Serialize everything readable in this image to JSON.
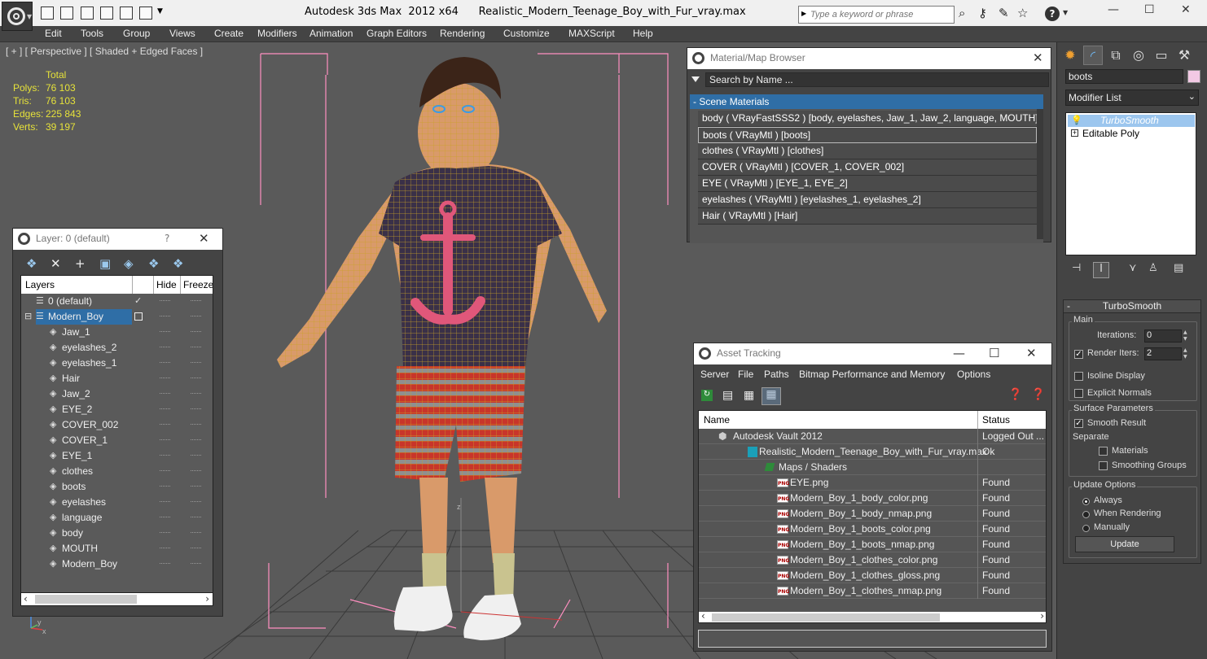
{
  "window": {
    "title": "Autodesk 3ds Max  2012 x64      Realistic_Modern_Teenage_Boy_with_Fur_vray.max",
    "search_placeholder": "Type a keyword or phrase"
  },
  "menu": [
    "Edit",
    "Tools",
    "Group",
    "Views",
    "Create",
    "Modifiers",
    "Animation",
    "Graph Editors",
    "Rendering",
    "Customize",
    "MAXScript",
    "Help"
  ],
  "viewport": {
    "label": "[ + ] [ Perspective ] [ Shaded + Edged Faces ]",
    "stats_header": "Total",
    "stats": [
      {
        "label": "Polys:",
        "value": "76 103"
      },
      {
        "label": "Tris:",
        "value": "76 103"
      },
      {
        "label": "Edges:",
        "value": "225 843"
      },
      {
        "label": "Verts:",
        "value": "39 197"
      }
    ],
    "axis_x": "x",
    "axis_y": "y",
    "axis_z": "z",
    "gizmo_z": "z"
  },
  "layer_panel": {
    "title": "Layer: 0 (default)",
    "help": "?",
    "columns": [
      "Layers",
      "Hide",
      "Freeze"
    ],
    "layers": [
      {
        "name": "0 (default)",
        "level": 0,
        "type": "layer",
        "selected": false,
        "active": true
      },
      {
        "name": "Modern_Boy",
        "level": 0,
        "type": "layer",
        "selected": true,
        "active": false
      },
      {
        "name": "Jaw_1",
        "level": 1,
        "type": "object"
      },
      {
        "name": "eyelashes_2",
        "level": 1,
        "type": "object"
      },
      {
        "name": "eyelashes_1",
        "level": 1,
        "type": "object"
      },
      {
        "name": "Hair",
        "level": 1,
        "type": "object"
      },
      {
        "name": "Jaw_2",
        "level": 1,
        "type": "object"
      },
      {
        "name": "EYE_2",
        "level": 1,
        "type": "object"
      },
      {
        "name": "COVER_002",
        "level": 1,
        "type": "object"
      },
      {
        "name": "COVER_1",
        "level": 1,
        "type": "object"
      },
      {
        "name": "EYE_1",
        "level": 1,
        "type": "object"
      },
      {
        "name": "clothes",
        "level": 1,
        "type": "object"
      },
      {
        "name": "boots",
        "level": 1,
        "type": "object"
      },
      {
        "name": "eyelashes",
        "level": 1,
        "type": "object"
      },
      {
        "name": "language",
        "level": 1,
        "type": "object"
      },
      {
        "name": "body",
        "level": 1,
        "type": "object"
      },
      {
        "name": "MOUTH",
        "level": 1,
        "type": "object"
      },
      {
        "name": "Modern_Boy",
        "level": 1,
        "type": "object"
      }
    ]
  },
  "material_browser": {
    "title": "Material/Map Browser",
    "search": "Search by Name ...",
    "group": "- Scene Materials",
    "materials": [
      "body  ( VRayFastSSS2 ) [body, eyelashes, Jaw_1, Jaw_2, language, MOUTH]",
      "boots  ( VRayMtl ) [boots]",
      "clothes  ( VRayMtl ) [clothes]",
      "COVER  ( VRayMtl ) [COVER_1, COVER_002]",
      "EYE  ( VRayMtl ) [EYE_1, EYE_2]",
      "eyelashes  ( VRayMtl ) [eyelashes_1, eyelashes_2]",
      "Hair  ( VRayMtl ) [Hair]"
    ],
    "selected_index": 1
  },
  "asset_tracking": {
    "title": "Asset Tracking",
    "menu": [
      "Server",
      "File",
      "Paths",
      "Bitmap Performance and Memory",
      "Options"
    ],
    "columns": [
      "Name",
      "Status"
    ],
    "rows": [
      {
        "name": "Autodesk Vault 2012",
        "status": "Logged Out ...",
        "level": 0,
        "icon": "vault"
      },
      {
        "name": "Realistic_Modern_Teenage_Boy_with_Fur_vray.max",
        "status": "Ok",
        "level": 1,
        "icon": "max"
      },
      {
        "name": "Maps / Shaders",
        "status": "",
        "level": 2,
        "icon": "maps"
      },
      {
        "name": "EYE.png",
        "status": "Found",
        "level": 3,
        "icon": "png"
      },
      {
        "name": "Modern_Boy_1_body_color.png",
        "status": "Found",
        "level": 3,
        "icon": "png"
      },
      {
        "name": "Modern_Boy_1_body_nmap.png",
        "status": "Found",
        "level": 3,
        "icon": "png"
      },
      {
        "name": "Modern_Boy_1_boots_color.png",
        "status": "Found",
        "level": 3,
        "icon": "png"
      },
      {
        "name": "Modern_Boy_1_boots_nmap.png",
        "status": "Found",
        "level": 3,
        "icon": "png"
      },
      {
        "name": "Modern_Boy_1_clothes_color.png",
        "status": "Found",
        "level": 3,
        "icon": "png"
      },
      {
        "name": "Modern_Boy_1_clothes_gloss.png",
        "status": "Found",
        "level": 3,
        "icon": "png"
      },
      {
        "name": "Modern_Boy_1_clothes_nmap.png",
        "status": "Found",
        "level": 3,
        "icon": "png"
      }
    ],
    "png_icon_text": "PNG"
  },
  "command_panel": {
    "object_name": "boots",
    "object_color": "#f2c9e4",
    "modifier_list_label": "Modifier List",
    "stack": [
      {
        "name": "TurboSmooth",
        "selected": true
      },
      {
        "name": "Editable Poly",
        "selected": false
      }
    ],
    "rollout_title": "TurboSmooth",
    "main_group": "Main",
    "iterations_label": "Iterations:",
    "iterations_value": "0",
    "render_iters_label": "Render Iters:",
    "render_iters_value": "2",
    "render_iters_checked": true,
    "isoline_label": "Isoline Display",
    "isoline_checked": false,
    "explicit_normals_label": "Explicit Normals",
    "explicit_normals_checked": false,
    "surface_group": "Surface Parameters",
    "smooth_result_label": "Smooth Result",
    "smooth_result_checked": true,
    "separate_label": "Separate",
    "materials_label": "Materials",
    "smoothing_groups_label": "Smoothing Groups",
    "update_group": "Update Options",
    "update_always": "Always",
    "update_when_rendering": "When Rendering",
    "update_manually": "Manually",
    "update_selected": "Always",
    "update_button": "Update"
  },
  "colors": {
    "selection_blue": "#2f6ea6",
    "wire_yellow": "#c9a227",
    "bbox_pink": "#ff8fc0",
    "stats_yellow": "#e6e23a"
  }
}
